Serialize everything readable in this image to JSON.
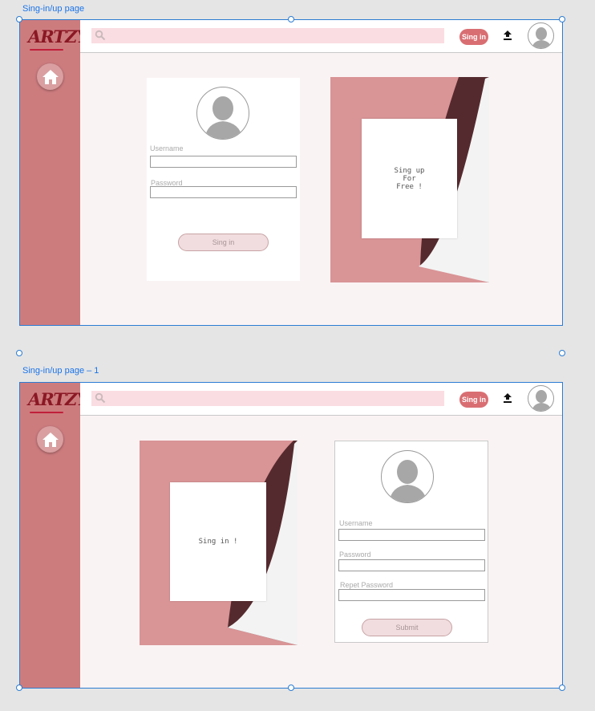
{
  "artboards": [
    {
      "label": "Sing-in/up page",
      "logo": "ARTZY",
      "topbar": {
        "signin_label": "Sing in"
      },
      "form": {
        "username_label": "Username",
        "password_label": "Password",
        "button_label": "Sing in"
      },
      "promo": {
        "text": "Sing up\nFor\nFree !"
      }
    },
    {
      "label": "Sing-in/up page – 1",
      "logo": "ARTZY",
      "topbar": {
        "signin_label": "Sing in"
      },
      "form": {
        "username_label": "Username",
        "password_label": "Password",
        "repeat_password_label": "Repet Password",
        "button_label": "Submit"
      },
      "promo": {
        "text": "Sing in !"
      }
    }
  ],
  "colors": {
    "sidebar": "#cd7c7e",
    "accent": "#d96e72",
    "promo_pink": "#d99496",
    "promo_dark": "#552a2e"
  },
  "icons": [
    "search-icon",
    "home-icon",
    "upload-icon",
    "user-avatar-icon"
  ]
}
